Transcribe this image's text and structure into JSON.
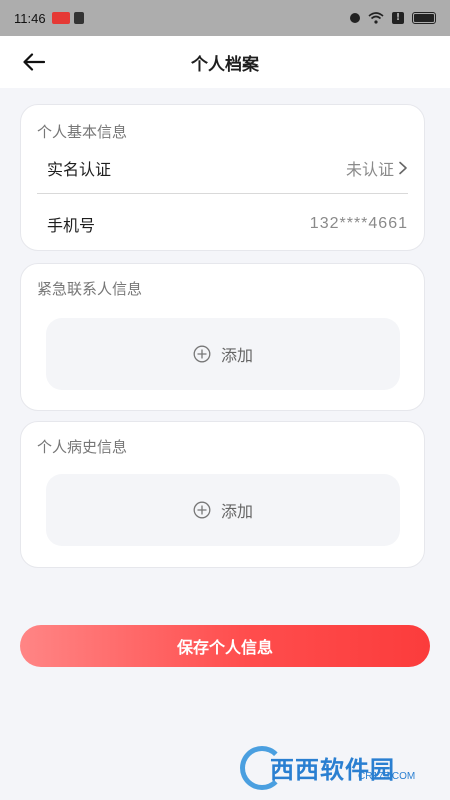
{
  "status_bar": {
    "time": "11:46"
  },
  "nav": {
    "title": "个人档案",
    "back_icon": "arrow-left-icon"
  },
  "basic_info": {
    "title": "个人基本信息",
    "realname_label": "实名认证",
    "realname_value": "未认证",
    "phone_label": "手机号",
    "phone_value": "132****4661"
  },
  "emergency_contact": {
    "title": "紧急联系人信息",
    "add_label": "添加"
  },
  "medical_history": {
    "title": "个人病史信息",
    "add_label": "添加"
  },
  "save_button_label": "保存个人信息",
  "watermark": {
    "text": "西西软件园",
    "sub": "CR173.COM"
  },
  "colors": {
    "accent": "#ff4d4d",
    "accent_light": "#ff8585",
    "background": "#f4f5f9"
  }
}
